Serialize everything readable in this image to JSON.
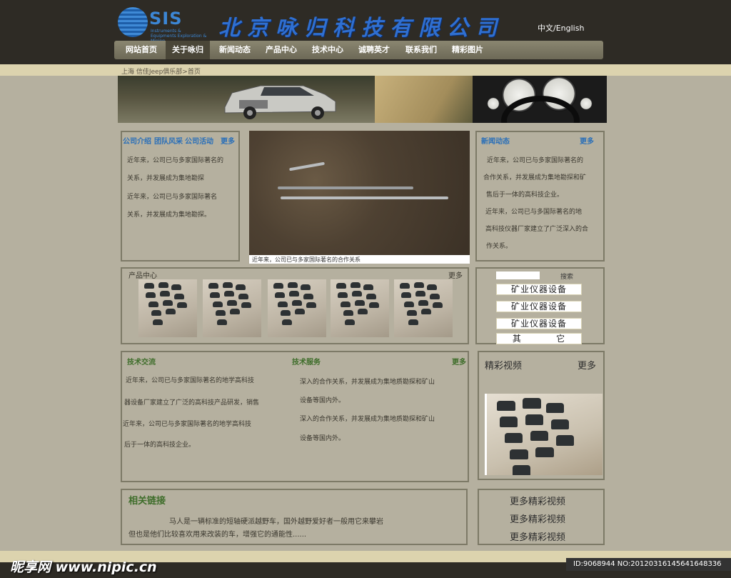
{
  "header": {
    "logo_text": "SIS",
    "logo_sub": "Instruments & Equipments Exploration & Mining",
    "company_name": "北京咏归科技有限公司",
    "language": "中文/English"
  },
  "nav": {
    "items": [
      "网站首页",
      "关于咏归",
      "新闻动态",
      "产品中心",
      "技术中心",
      "诚聘英才",
      "联系我们",
      "精彩图片"
    ],
    "active": "关于咏归"
  },
  "breadcrumb": "上海  信佳Jeep俱乐部>首页",
  "intro": {
    "tabs": [
      "公司介绍",
      "团队风采",
      "公司活动"
    ],
    "more": "更多",
    "lines": [
      "近年来，公司已与多家国际著名的",
      "关系，并发展成为集地勘探",
      "近年来，公司已与多家国际著名",
      "关系，并发展成为集地勘探。"
    ]
  },
  "photo": {
    "caption": "近年来，公司已与多家国际著名的合作关系"
  },
  "news": {
    "title": "新闻动态",
    "more": "更多",
    "lines": [
      "近年来，公司已与多家国际著名的",
      "合作关系，并发展成为集地勘探和矿",
      "售后于一体的高科技企业。",
      "近年来，公司已与多国际著名的地",
      "高科技仪器厂家建立了广泛深入的合",
      "作关系。"
    ]
  },
  "products": {
    "title": "产品中心",
    "more": "更多"
  },
  "search": {
    "placeholder": "",
    "button": "搜索",
    "categories": [
      "矿业仪器设备",
      "矿业仪器设备",
      "矿业仪器设备",
      "其          它"
    ]
  },
  "tech": {
    "title_left": "技术交流",
    "title_right": "技术服务",
    "more": "更多",
    "left_lines": [
      "近年来，公司已与多家国际著名的地学高科技",
      "器设备厂家建立了广泛的高科技产品研发，销售",
      "近年来，公司已与多家国际著名的地学高科技",
      "后于一体的高科技企业。"
    ],
    "right_lines": [
      "深入的合作关系，并发展成为集地质勘探和矿山",
      "设备等国内外。",
      "深入的合作关系，并发展成为集地质勘探和矿山",
      "设备等国内外。"
    ]
  },
  "videos": {
    "title": "精彩视频",
    "more": "更多",
    "more_links": [
      "更多精彩视频",
      "更多精彩视频",
      "更多精彩视频"
    ]
  },
  "links": {
    "title": "相关链接",
    "line1": "马人是一辆标准的短轴硬派越野车，国外越野爱好者一般用它来攀岩",
    "line2": "但也是他们比较喜欢用来改装的车，增强它的通能性......"
  },
  "footer": {
    "watermark": "昵享网 www.nipic.cn",
    "id_text": "ID:9068944 NO:20120316145641648336"
  },
  "colors": {
    "page_bg": "#b5b09f",
    "header_bg": "#2e2b25",
    "accent_blue": "#2a6fb8",
    "green_title": "#3e6d2a",
    "band": "#dcd3ae"
  }
}
